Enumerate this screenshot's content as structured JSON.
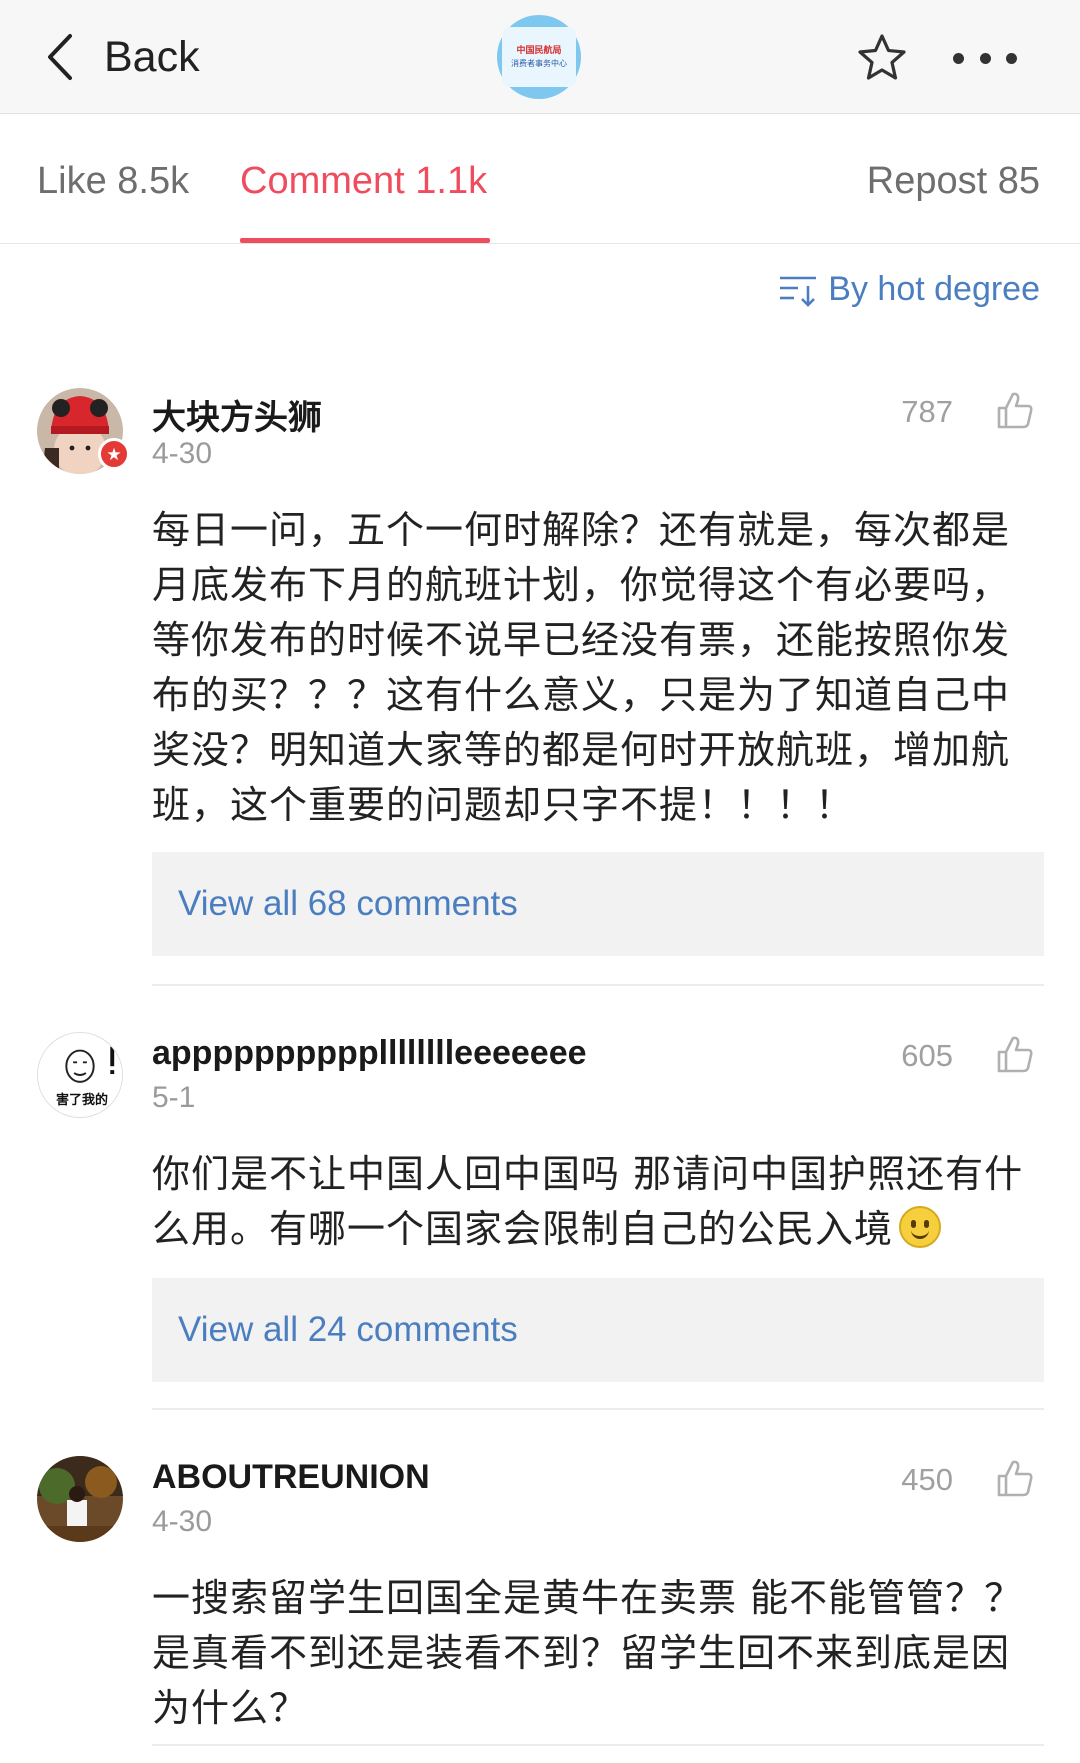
{
  "nav": {
    "back_label": "Back",
    "logo_line1": "中国民航局",
    "logo_line2": "消费者事务中心",
    "icons": {
      "back": "chevron-left-icon",
      "favorite": "star-icon",
      "more": "more-dots-icon"
    }
  },
  "tabs": {
    "like": "Like 8.5k",
    "comment": "Comment 1.1k",
    "repost": "Repost 85",
    "active": "comment",
    "active_color": "#ef4d5d"
  },
  "sort": {
    "label": "By hot degree",
    "icon": "sort-icon"
  },
  "link_color": "#4a7ec0",
  "comments": [
    {
      "username": "大块方头狮",
      "date": "4-30",
      "likes": "787",
      "text": "每日一问，五个一何时解除？还有就是，每次都是月底发布下月的航班计划，你觉得这个有必要吗，等你发布的时候不说早已经没有票，还能按照你发布的买？？？这有什么意义，只是为了知道自己中奖没？明知道大家等的都是何时开放航班，增加航班，这个重要的问题却只字不提！！！！",
      "view_all": "View all 68 comments",
      "verified": true
    },
    {
      "username": "apppppppppplllllllleeeeeee",
      "date": "5-1",
      "likes": "605",
      "text": "你们是不让中国人回中国吗 那请问中国护照还有什么用。有哪一个国家会限制自己的公民入境",
      "view_all": "View all 24 comments",
      "avatar_caption": "害了我的"
    },
    {
      "username": "ABOUTREUNION",
      "date": "4-30",
      "likes": "450",
      "text": "一搜索留学生回国全是黄牛在卖票 能不能管管？？是真看不到还是装看不到？留学生回不来到底是因为什么？"
    }
  ]
}
